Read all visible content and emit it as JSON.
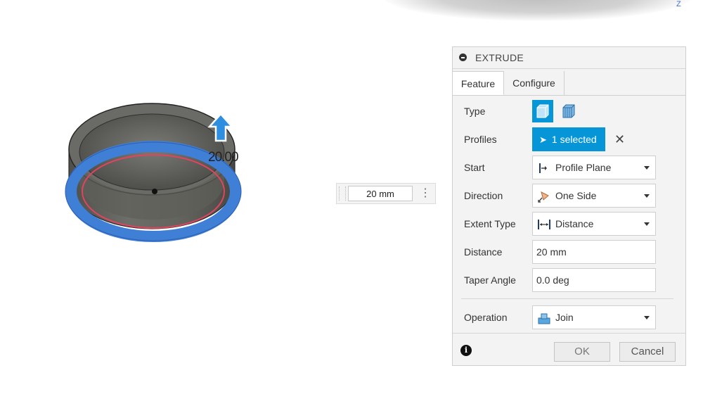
{
  "viewport": {
    "axis_label": "Z",
    "dimension_label": "20.00",
    "floating_input": {
      "value": "20 mm"
    }
  },
  "dialog": {
    "title": "EXTRUDE",
    "tabs": [
      "Feature",
      "Configure"
    ],
    "fields": {
      "type": {
        "label": "Type"
      },
      "profiles": {
        "label": "Profiles",
        "value": "1 selected"
      },
      "start": {
        "label": "Start",
        "value": "Profile Plane"
      },
      "direction": {
        "label": "Direction",
        "value": "One Side"
      },
      "extent_type": {
        "label": "Extent Type",
        "value": "Distance"
      },
      "distance": {
        "label": "Distance",
        "value": "20 mm"
      },
      "taper_angle": {
        "label": "Taper Angle",
        "value": "0.0 deg"
      },
      "operation": {
        "label": "Operation",
        "value": "Join"
      }
    },
    "buttons": {
      "ok": "OK",
      "cancel": "Cancel"
    }
  },
  "colors": {
    "accent": "#0696d7",
    "model_body": "#5d5d59",
    "selected_face": "#3f7fd6",
    "profile_outline": "#e0455d"
  }
}
